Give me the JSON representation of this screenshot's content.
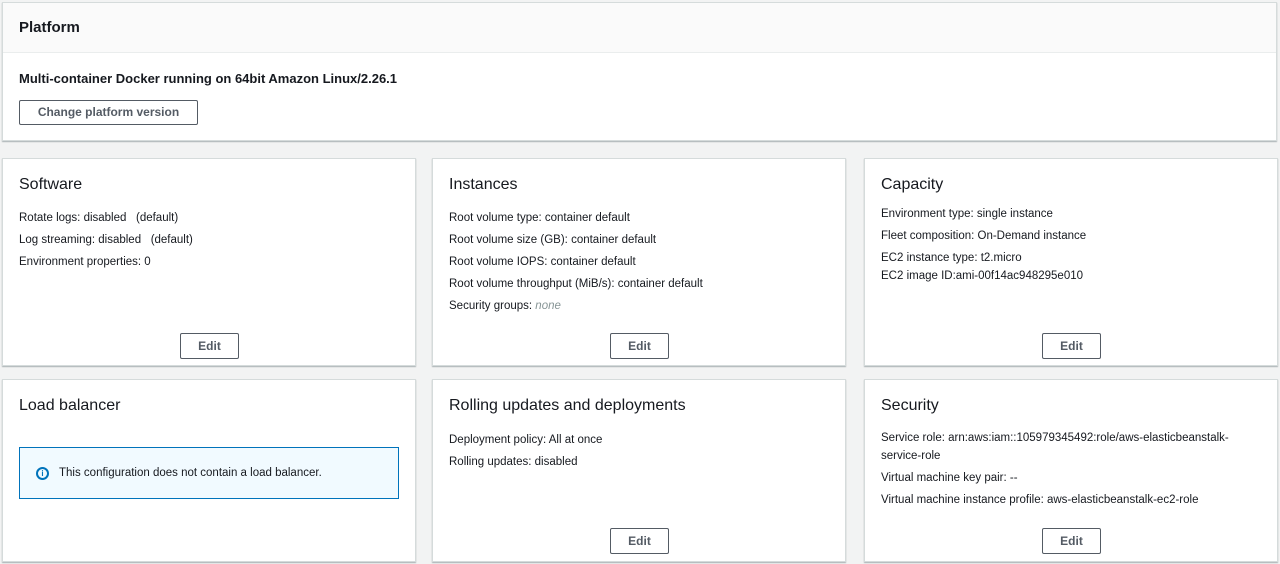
{
  "platform": {
    "title": "Platform",
    "version": "Multi-container Docker running on 64bit Amazon Linux/2.26.1",
    "change_button": "Change platform version"
  },
  "edit_label": "Edit",
  "software": {
    "title": "Software",
    "rows": [
      "Rotate logs: disabled   (default)",
      "Log streaming: disabled   (default)",
      "Environment properties: 0"
    ]
  },
  "instances": {
    "title": "Instances",
    "rows": [
      "Root volume type: container default",
      "Root volume size (GB): container default",
      "Root volume IOPS: container default",
      "Root volume throughput (MiB/s): container default"
    ],
    "security_groups_label": "Security groups: ",
    "security_groups_value": "none"
  },
  "capacity": {
    "title": "Capacity",
    "rows": [
      "Environment type: single instance",
      "Fleet composition: On-Demand instance"
    ],
    "instance_type": "EC2 instance type: t2.micro",
    "image_id": "EC2 image ID:ami-00f14ac948295e010"
  },
  "load_balancer": {
    "title": "Load balancer",
    "alert": "This configuration does not contain a load balancer."
  },
  "rolling": {
    "title": "Rolling updates and deployments",
    "rows": [
      "Deployment policy: All at once",
      "Rolling updates: disabled"
    ]
  },
  "security": {
    "title": "Security",
    "service_role_1": "Service role: arn:aws:iam::105979345492:role/aws-elasticbeanstalk-",
    "service_role_2": "service-role",
    "key_pair": "Virtual machine key pair: --",
    "instance_profile": "Virtual machine instance profile: aws-elasticbeanstalk-ec2-role"
  }
}
